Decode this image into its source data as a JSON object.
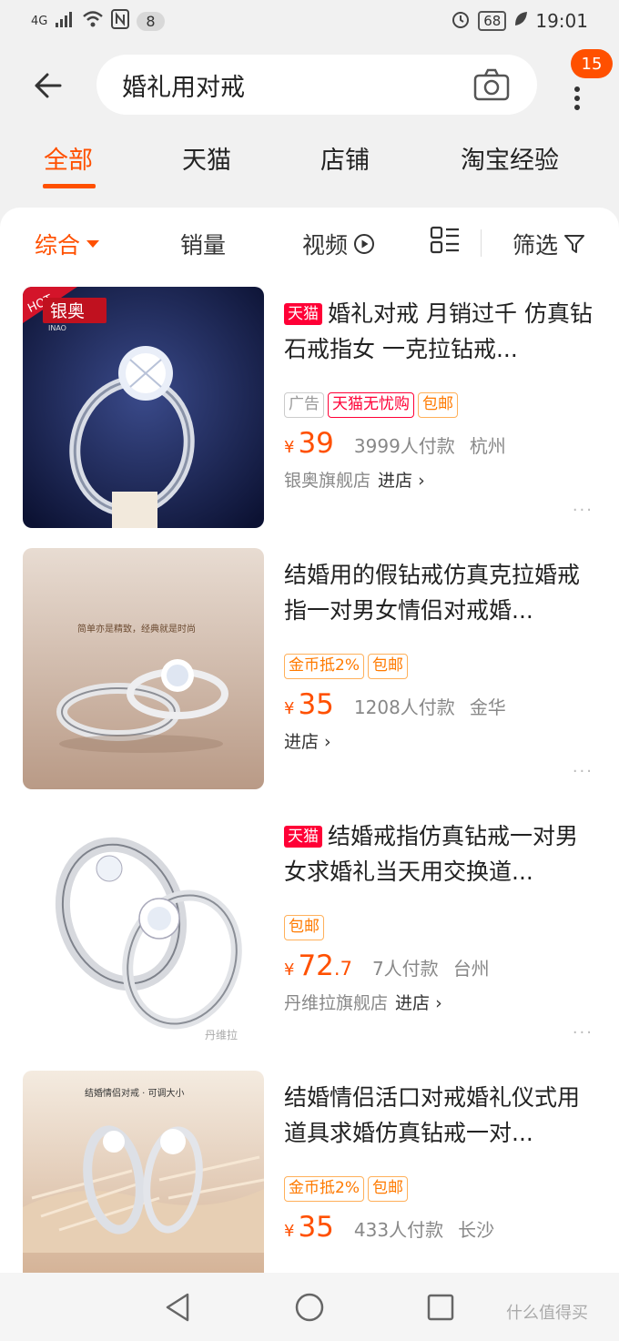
{
  "status_bar": {
    "network": "4G",
    "notification_count": "8",
    "battery": "68",
    "time": "19:01"
  },
  "search": {
    "query": "婚礼用对戒",
    "badge_count": "15"
  },
  "tabs": [
    {
      "label": "全部",
      "active": true
    },
    {
      "label": "天猫",
      "active": false
    },
    {
      "label": "店铺",
      "active": false
    },
    {
      "label": "淘宝经验",
      "active": false
    }
  ],
  "sort": {
    "comprehensive": "综合",
    "sales": "销量",
    "video": "视频",
    "filter": "筛选"
  },
  "products": [
    {
      "tmall_tag": "天猫",
      "title": "婚礼对戒 月销过千 仿真钻石戒指女 一克拉钻戒...",
      "tags": [
        "广告",
        "天猫无忧购",
        "包邮"
      ],
      "currency": "¥",
      "price": "39",
      "price_decimal": "",
      "sales": "3999人付款",
      "location": "杭州",
      "shop": "银奥旗舰店",
      "enter": "进店",
      "image_hot": "HOT",
      "image_brand": "银奥",
      "image_brand_en": "INAO"
    },
    {
      "tmall_tag": "",
      "title": "结婚用的假钻戒仿真克拉婚戒指一对男女情侣对戒婚...",
      "tags": [
        "金币抵2%",
        "包邮"
      ],
      "currency": "¥",
      "price": "35",
      "price_decimal": "",
      "sales": "1208人付款",
      "location": "金华",
      "shop": "",
      "enter": "进店",
      "image_caption": "简单亦是精致，经典就是时尚"
    },
    {
      "tmall_tag": "天猫",
      "title": "结婚戒指仿真钻戒一对男女求婚礼当天用交换道...",
      "tags": [
        "包邮"
      ],
      "currency": "¥",
      "price": "72",
      "price_decimal": ".7",
      "sales": "7人付款",
      "location": "台州",
      "shop": "丹维拉旗舰店",
      "enter": "进店",
      "image_brand": "丹维拉"
    },
    {
      "tmall_tag": "",
      "title": "结婚情侣活口对戒婚礼仪式用道具求婚仿真钻戒一对...",
      "tags": [
        "金币抵2%",
        "包邮"
      ],
      "currency": "¥",
      "price": "35",
      "price_decimal": "",
      "sales": "433人付款",
      "location": "长沙",
      "shop": "",
      "enter": "",
      "image_caption": "结婚情侣对戒 · 可调大小"
    }
  ],
  "watermark": "什么值得买",
  "colors": {
    "accent": "#ff5000",
    "tmall_red": "#ff0036",
    "coupon_orange": "#ff7a00"
  }
}
